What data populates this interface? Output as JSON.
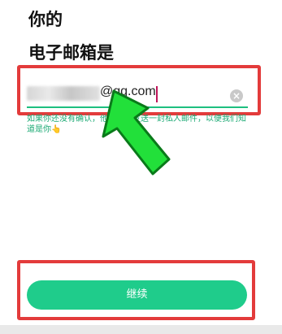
{
  "heading": {
    "line1": "你的",
    "line2": "电子邮箱是"
  },
  "email": {
    "value": "@qq.com"
  },
  "clear_label": "×",
  "hint_text": "如果你还没有确认，他们会给发送一封私人邮件，以便我们知道是你👆",
  "continue_label": "继续",
  "colors": {
    "accent": "#1fcc8b",
    "highlight": "#e33b3b",
    "arrow": "#22e03a"
  }
}
